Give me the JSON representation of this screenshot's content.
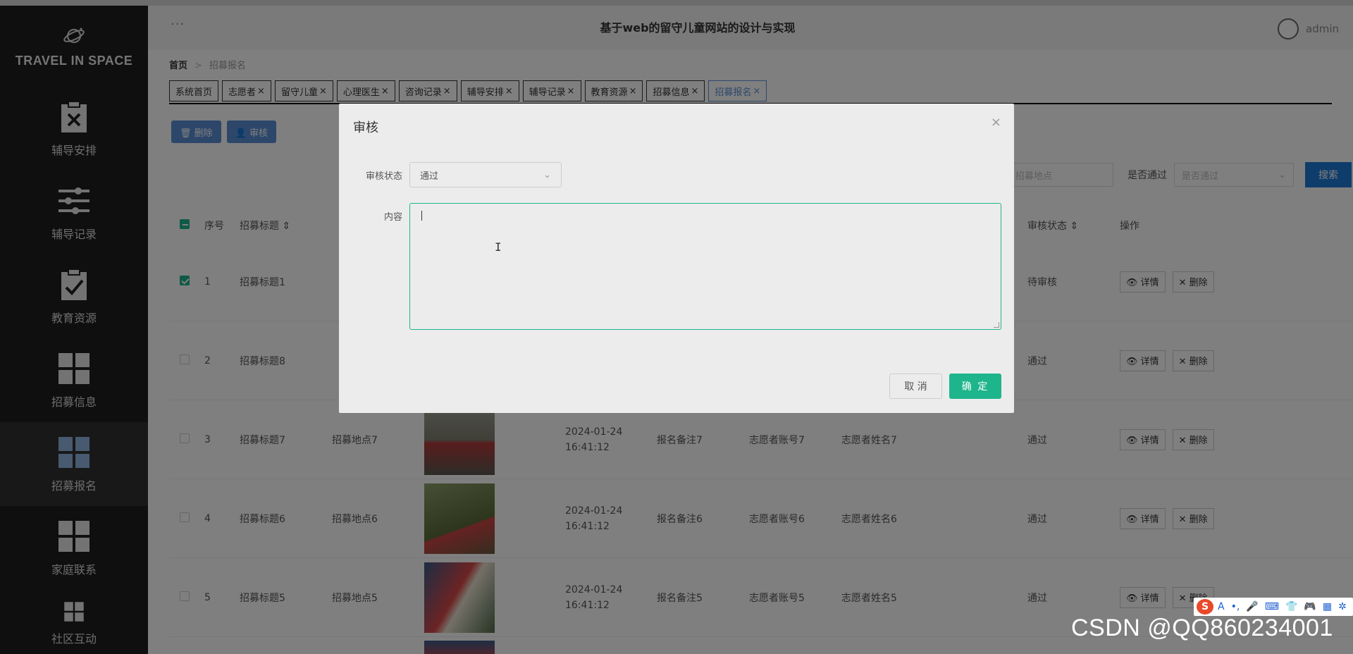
{
  "sidebar": {
    "brand": "TRAVEL IN SPACE",
    "items": [
      {
        "label": "辅导安排",
        "icon": "clipboard-x-icon"
      },
      {
        "label": "辅导记录",
        "icon": "sliders-icon"
      },
      {
        "label": "教育资源",
        "icon": "clipboard-check-icon"
      },
      {
        "label": "招募信息",
        "icon": "grid-icon"
      },
      {
        "label": "招募报名",
        "icon": "grid-icon",
        "active": true
      },
      {
        "label": "家庭联系",
        "icon": "grid-icon"
      },
      {
        "label": "社区互动",
        "icon": "grid-icon"
      }
    ]
  },
  "header": {
    "dots": "···",
    "title": "基于web的留守儿童网站的设计与实现",
    "user": "admin"
  },
  "breadcrumb": {
    "home": "首页",
    "sep": ">",
    "current": "招募报名"
  },
  "tabs": [
    {
      "label": "系统首页",
      "close": ""
    },
    {
      "label": "志愿者",
      "close": "×"
    },
    {
      "label": "留守儿童",
      "close": "×"
    },
    {
      "label": "心理医生",
      "close": "×"
    },
    {
      "label": "咨询记录",
      "close": "×"
    },
    {
      "label": "辅导安排",
      "close": "×"
    },
    {
      "label": "辅导记录",
      "close": "×"
    },
    {
      "label": "教育资源",
      "close": "×"
    },
    {
      "label": "招募信息",
      "close": "×"
    },
    {
      "label": "招募报名",
      "close": "×",
      "active": true
    }
  ],
  "toolbar": {
    "delete": "🗑 删除",
    "review": "👤 审核"
  },
  "search": {
    "location_placeholder": "招募地点",
    "passed_label": "是否通过",
    "passed_placeholder": "是否通过",
    "button": "搜索"
  },
  "table": {
    "headers": {
      "idx": "序号",
      "title": "招募标题 ⇕",
      "status": "审核状态 ⇕",
      "ops": "操作"
    },
    "detail_label": "👁 详情",
    "delete_label": "✕ 删除",
    "rows": [
      {
        "idx": "1",
        "title": "招募标题1",
        "location": "",
        "time": "",
        "note": "",
        "account": "",
        "name": "",
        "status": "待审核",
        "checked": true
      },
      {
        "idx": "2",
        "title": "招募标题8",
        "location": "",
        "time": "",
        "note": "",
        "account": "",
        "name": "",
        "status": "通过"
      },
      {
        "idx": "3",
        "title": "招募标题7",
        "location": "招募地点7",
        "time": "2024-01-24 16:41:12",
        "note": "报名备注7",
        "account": "志愿者账号7",
        "name": "志愿者姓名7",
        "status": "通过"
      },
      {
        "idx": "4",
        "title": "招募标题6",
        "location": "招募地点6",
        "time": "2024-01-24 16:41:12",
        "note": "报名备注6",
        "account": "志愿者账号6",
        "name": "志愿者姓名6",
        "status": "通过"
      },
      {
        "idx": "5",
        "title": "招募标题5",
        "location": "招募地点5",
        "time": "2024-01-24 16:41:12",
        "note": "报名备注5",
        "account": "志愿者账号5",
        "name": "志愿者姓名5",
        "status": "通过"
      }
    ]
  },
  "dialog": {
    "title": "审核",
    "close": "×",
    "status_label": "审核状态",
    "status_value": "通过",
    "content_label": "内容",
    "content_value": "",
    "cancel": "取 消",
    "ok": "确 定"
  },
  "ime": {
    "logo": "S",
    "glyphs": [
      "A",
      "•,",
      "🎤",
      "⌨",
      "👕",
      "🎮",
      "▦",
      "✲"
    ]
  },
  "watermark": "CSDN @QQ860234001",
  "colors": {
    "accent": "#1fb58c",
    "primary": "#5b8fd6",
    "sidebar": "#1f1f1f"
  }
}
